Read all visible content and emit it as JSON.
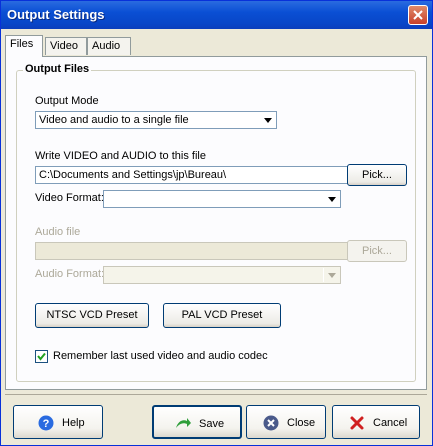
{
  "window": {
    "title": "Output Settings"
  },
  "tabs": [
    {
      "label": "Files",
      "active": true
    },
    {
      "label": "Video",
      "active": false
    },
    {
      "label": "Audio",
      "active": false
    }
  ],
  "output_files": {
    "group_title": "Output Files",
    "output_mode_label": "Output Mode",
    "output_mode_value": "Video and audio to a single file",
    "write_label": "Write VIDEO and AUDIO to this file",
    "write_path": "C:\\Documents and Settings\\jp\\Bureau\\",
    "pick_label": "Pick...",
    "video_format_label": "Video Format:",
    "video_format_value": "",
    "audio_file_label": "Audio file",
    "audio_file_value": "",
    "audio_pick_label": "Pick...",
    "audio_format_label": "Audio Format:",
    "audio_format_value": "",
    "ntsc_label": "NTSC VCD Preset",
    "pal_label": "PAL VCD Preset",
    "remember_label": "Remember last used video and audio codec",
    "remember_checked": true
  },
  "footer": {
    "help_label": "Help",
    "save_label": "Save",
    "close_label": "Close",
    "cancel_label": "Cancel"
  },
  "colors": {
    "titlebar": "#0a4fd4",
    "face": "#ece9d8",
    "panel": "#fcfcfe",
    "close_red": "#c8412a",
    "help_blue": "#2a6be0",
    "save_green": "#2f9e3a",
    "cancel_red": "#d02020"
  },
  "icons": {
    "help": "help-icon",
    "save": "save-arrow-icon",
    "close": "close-circle-icon",
    "cancel": "cancel-x-icon"
  }
}
